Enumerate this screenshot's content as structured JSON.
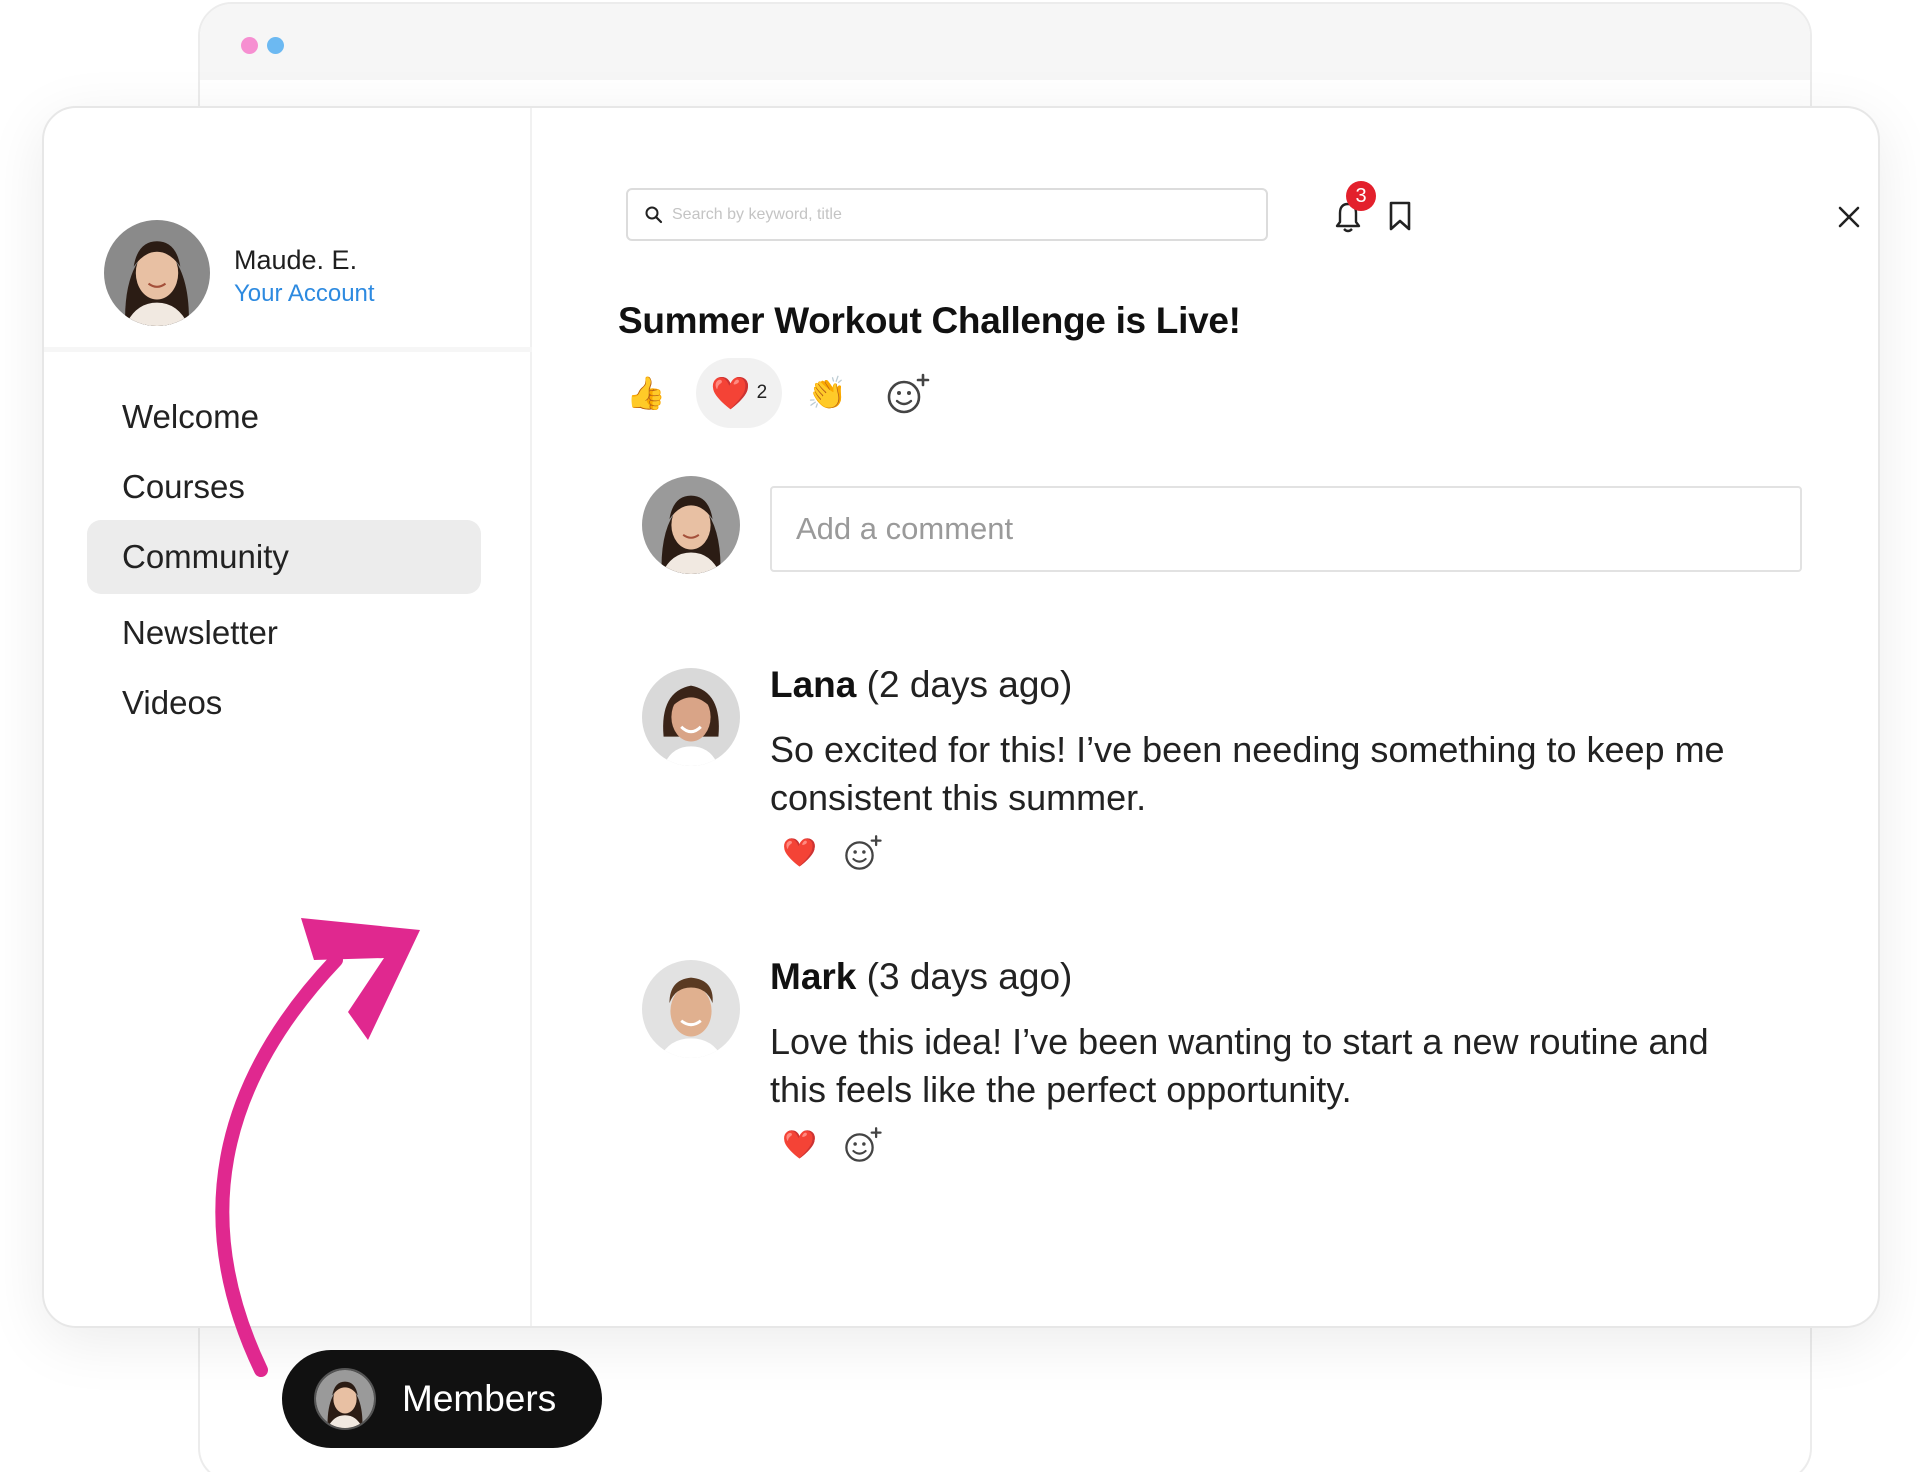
{
  "window": {
    "dots": [
      "#f68fd1",
      "#6cb9f2"
    ]
  },
  "profile": {
    "name": "Maude. E.",
    "link": "Your Account"
  },
  "nav": {
    "items": [
      {
        "label": "Welcome",
        "active": false
      },
      {
        "label": "Courses",
        "active": false
      },
      {
        "label": "Community",
        "active": true
      },
      {
        "label": "Newsletter",
        "active": false
      },
      {
        "label": "Videos",
        "active": false
      }
    ]
  },
  "search": {
    "placeholder": "Search by keyword, title"
  },
  "header": {
    "notification_count": "3",
    "icons": [
      "search-icon",
      "bell-icon",
      "bookmark-icon",
      "close-icon"
    ]
  },
  "post": {
    "title": "Summer Workout Challenge is Live!",
    "reactions": [
      {
        "emoji": "👍",
        "name": "thumbs-up-icon"
      },
      {
        "emoji": "❤️",
        "name": "heart-icon",
        "count": "2"
      },
      {
        "emoji": "👏",
        "name": "clapping-hands-icon"
      }
    ]
  },
  "comment_box": {
    "placeholder": "Add a comment"
  },
  "comments": [
    {
      "author": "Lana",
      "time": "(2 days ago)",
      "text": "So excited for this! I’ve been needing something to keep me consistent this summer.",
      "reaction": "❤️"
    },
    {
      "author": "Mark",
      "time": "(3 days ago)",
      "text": "Love this idea! I’ve been wanting to start a new routine and this feels like the perfect opportunity.",
      "reaction": "❤️"
    }
  ],
  "members": {
    "label": "Members"
  },
  "colors": {
    "accent_link": "#2d8ae0",
    "badge": "#e3202c",
    "arrow": "#e0288f",
    "pill": "#111111"
  }
}
